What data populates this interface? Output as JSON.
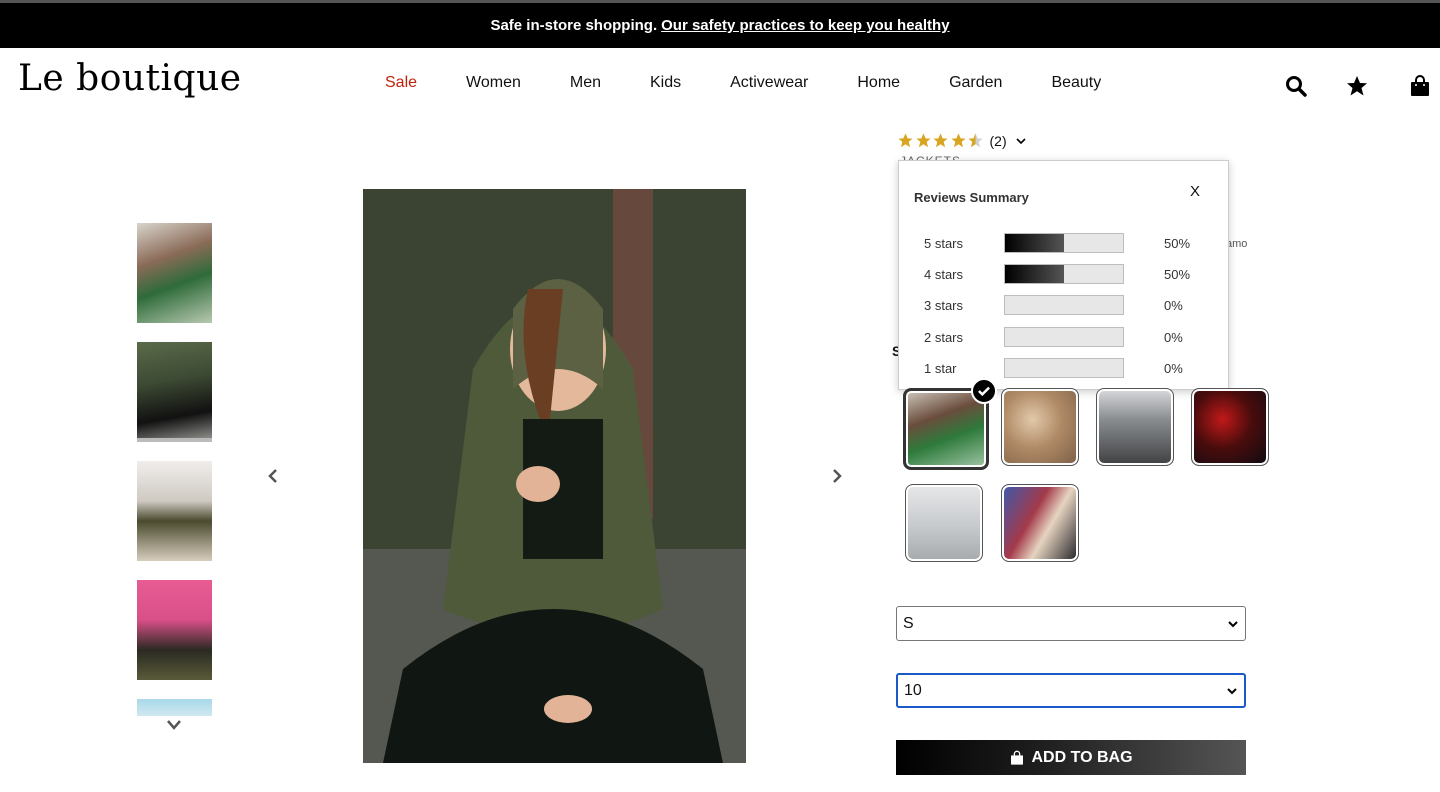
{
  "banner": {
    "text": "Safe in-store shopping.",
    "link": "Our safety practices to keep you healthy"
  },
  "header": {
    "logo": "Le boutique",
    "nav": [
      "Sale",
      "Women",
      "Men",
      "Kids",
      "Activewear",
      "Home",
      "Garden",
      "Beauty"
    ],
    "icons": [
      "search-icon",
      "star-icon",
      "shopping-bag-icon"
    ]
  },
  "gallery": {
    "thumbnails": 5,
    "selected_thumbnail": 2
  },
  "product": {
    "rating": 4.5,
    "review_count": "(2)",
    "category_peek": "JACKETS",
    "description_peek": "amo",
    "section_peek": "S"
  },
  "reviews_summary": {
    "title": "Reviews Summary",
    "close": "X",
    "rows": [
      {
        "label": "5 stars",
        "percent": "50%",
        "fraction": 0.5
      },
      {
        "label": "4 stars",
        "percent": "50%",
        "fraction": 0.5
      },
      {
        "label": "3 stars",
        "percent": "0%",
        "fraction": 0
      },
      {
        "label": "2 stars",
        "percent": "0%",
        "fraction": 0
      },
      {
        "label": "1 star",
        "percent": "0%",
        "fraction": 0
      }
    ]
  },
  "selects": {
    "size": "S",
    "quantity": "10"
  },
  "cta": {
    "add_to_bag": "ADD TO BAG"
  },
  "colors": {
    "accent_sale": "#c0230c",
    "star": "#d8a521",
    "focus": "#1a59c8"
  }
}
